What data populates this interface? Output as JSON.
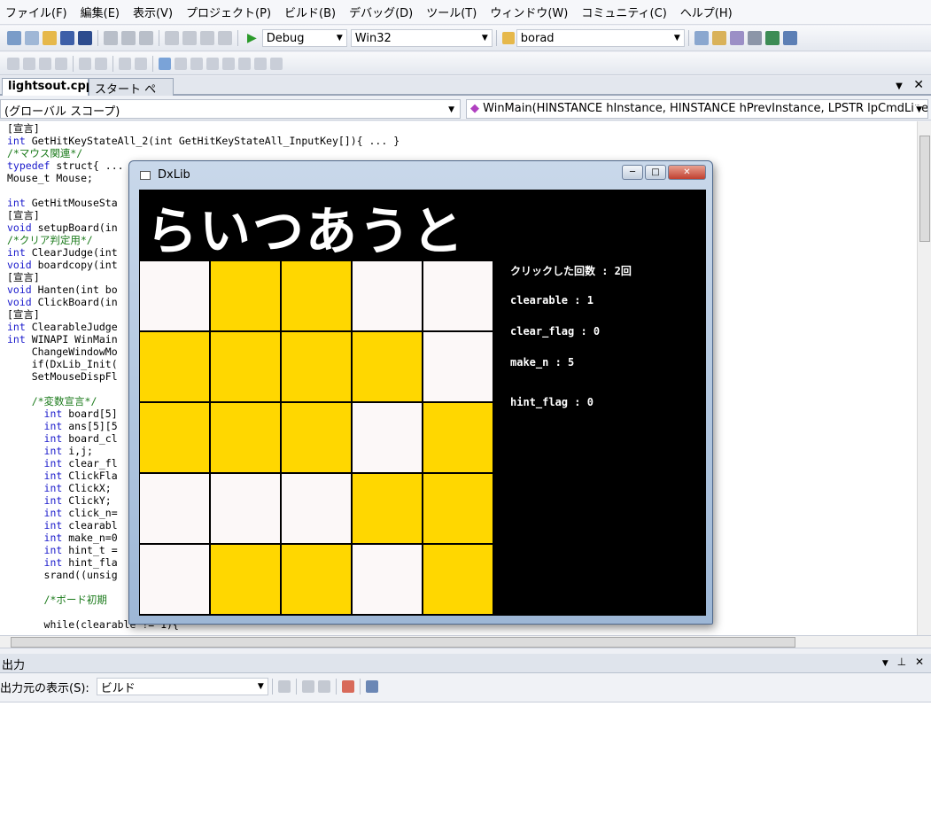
{
  "menu": [
    "ファイル(F)",
    "編集(E)",
    "表示(V)",
    "プロジェクト(P)",
    "ビルド(B)",
    "デバッグ(D)",
    "ツール(T)",
    "ウィンドウ(W)",
    "コミュニティ(C)",
    "ヘルプ(H)"
  ],
  "toolbar": {
    "config": "Debug",
    "platform": "Win32",
    "project": "borad"
  },
  "tabs": {
    "active": "lightsout.cpp",
    "other": "スタート ページ"
  },
  "scope": {
    "left": "(グローバル スコープ)",
    "right": "WinMain(HINSTANCE hInstance, HINSTANCE hPrevInstance, LPSTR lpCmdLine, in"
  },
  "code_lines": [
    "[宣言]",
    "int GetHitKeyStateAll_2(int GetHitKeyStateAll_InputKey[]){ ... }",
    "/*マウス関連*/",
    "typedef struct{ ... }",
    "Mouse_t Mouse;",
    "",
    "int GetHitMouseSta",
    "[宣言]",
    "void setupBoard(in",
    "/*クリア判定用*/",
    "int ClearJudge(int",
    "void boardcopy(int",
    "[宣言]",
    "void Hanten(int bo",
    "void ClickBoard(in",
    "[宣言]",
    "int ClearableJudge",
    "int WINAPI WinMain",
    "    ChangeWindowMo",
    "    if(DxLib_Init(",
    "    SetMouseDispFl",
    "",
    "    /*変数宣言*/",
    "      int board[5]",
    "      int ans[5][5",
    "      int board_cl",
    "      int i,j;",
    "      int clear_fl",
    "      int ClickFla",
    "      int ClickX;",
    "      int ClickY;",
    "      int click_n=",
    "      int clearabl",
    "      int make_n=0",
    "      int hint_t =",
    "      int hint_fla",
    "      srand((unsig",
    "",
    "      /*ボード初期",
    "",
    "      while(clearable != 1){"
  ],
  "dxlib": {
    "title": "DxLib",
    "game_title": "らいつあうと",
    "board": [
      [
        0,
        1,
        1,
        0,
        0
      ],
      [
        1,
        1,
        1,
        1,
        0
      ],
      [
        1,
        1,
        1,
        0,
        1
      ],
      [
        0,
        0,
        0,
        1,
        1
      ],
      [
        0,
        1,
        1,
        0,
        1
      ]
    ],
    "colors": {
      "on": "#ffd700",
      "off": "#fcf8f8"
    },
    "click_count": "クリックした回数 : 2回",
    "clearable": "clearable : 1",
    "clear_flag": "clear_flag : 0",
    "make_n": "make_n : 5",
    "hint_flag": "hint_flag : 0"
  },
  "output": {
    "title": "出力",
    "source_label": "出力元の表示(S):",
    "source_value": "ビルド"
  }
}
